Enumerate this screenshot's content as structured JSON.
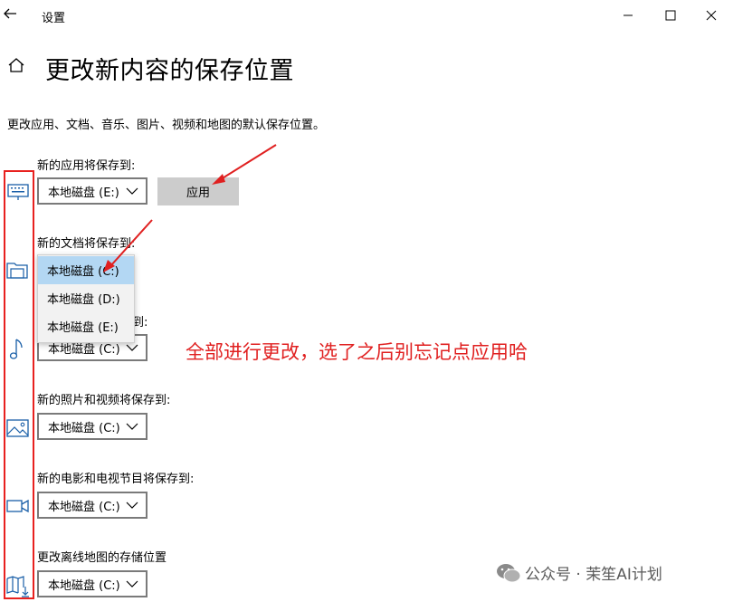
{
  "window": {
    "title": "设置"
  },
  "page": {
    "title": "更改新内容的保存位置",
    "description": "更改应用、文档、音乐、图片、视频和地图的默认保存位置。"
  },
  "sections": [
    {
      "label": "新的应用将保存到:",
      "value": "本地磁盘 (E:)",
      "icon": "monitor-keyboard-icon"
    },
    {
      "label": "新的文档将保存到:",
      "value": "本地磁盘 (C:)",
      "icon": "folder-documents-icon"
    },
    {
      "label": "新的音乐将保存到:",
      "value": "本地磁盘 (C:)",
      "icon": "music-note-icon"
    },
    {
      "label": "新的照片和视频将保存到:",
      "value": "本地磁盘 (C:)",
      "icon": "picture-icon"
    },
    {
      "label": "新的电影和电视节目将保存到:",
      "value": "本地磁盘 (C:)",
      "icon": "video-camera-icon"
    },
    {
      "label": "更改离线地图的存储位置",
      "value": "本地磁盘 (C:)",
      "icon": "map-download-icon"
    }
  ],
  "apply_button": "应用",
  "document_dropdown_options": [
    "本地磁盘 (C:)",
    "本地磁盘 (D:)",
    "本地磁盘 (E:)"
  ],
  "music_label_visible": "到:",
  "annotation": "全部进行更改，选了之后别忘记点应用哈",
  "watermark": "公众号 · 茉笙AI计划",
  "colors": {
    "annotation_red": "#e02020",
    "selected_option": "#b3d7f3",
    "apply_bg": "#cccccc"
  }
}
